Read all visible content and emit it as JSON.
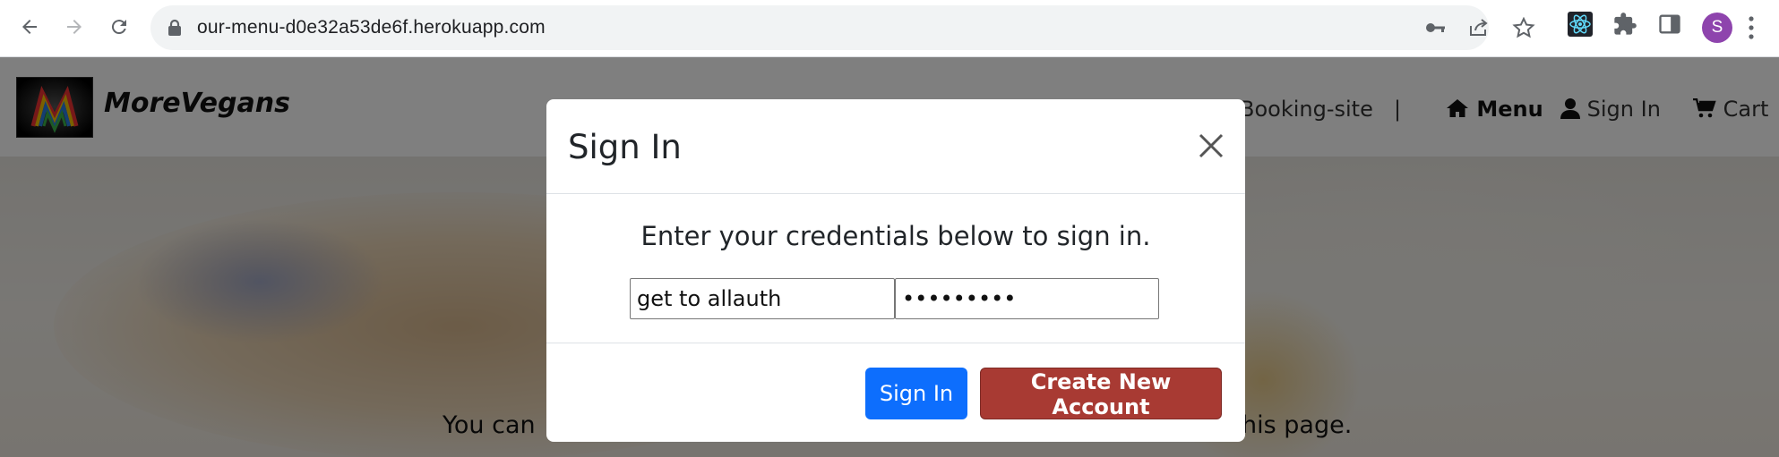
{
  "browser": {
    "url": "our-menu-d0e32a53de6f.herokuapp.com",
    "back_icon": "arrow-left-icon",
    "forward_icon": "arrow-right-icon",
    "reload_icon": "reload-icon",
    "lock_icon": "lock-icon",
    "key_icon": "key-icon",
    "share_icon": "share-icon",
    "star_icon": "star-icon",
    "extension_icons": [
      "react-devtools-icon",
      "puzzle-icon",
      "side-panel-icon"
    ],
    "profile_initial": "S",
    "profile_color": "#8e44ad",
    "menu_icon": "three-dots-vertical-icon"
  },
  "site": {
    "brand": "MoreVegans",
    "nav": {
      "booking": "Booking-site",
      "separator": "|",
      "menu": "Menu",
      "sign_in": "Sign In",
      "cart": "Cart"
    },
    "hero_line1_left": "You can",
    "hero_line1_right": "his page."
  },
  "modal": {
    "title": "Sign In",
    "prompt": "Enter your credentials below to sign in.",
    "username_value": "get to allauth",
    "password_value": "•••••••••",
    "sign_in_label": "Sign In",
    "create_account_label": "Create New Account",
    "primary_color": "#0d6efd",
    "danger_color": "#a83a33"
  }
}
